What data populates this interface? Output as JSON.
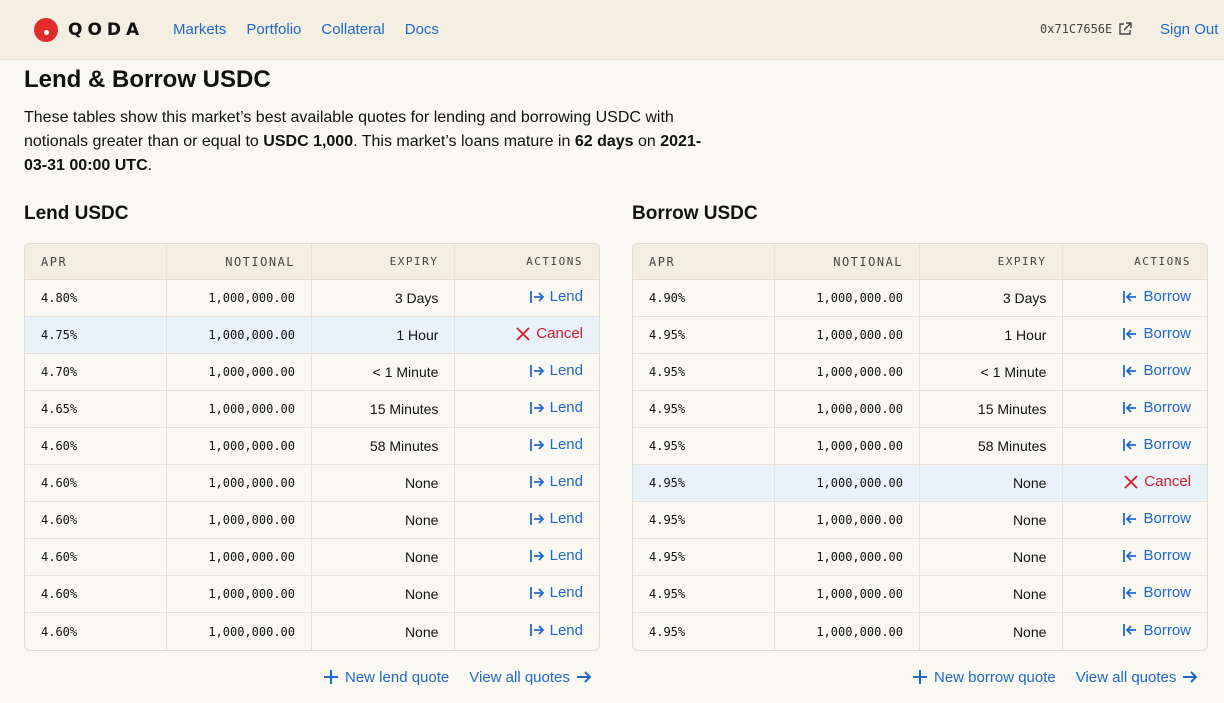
{
  "brand": {
    "name": "QODA"
  },
  "nav": {
    "items": [
      "Markets",
      "Portfolio",
      "Collateral",
      "Docs"
    ]
  },
  "header": {
    "wallet": "0x71C7656E",
    "sign_out": "Sign Out"
  },
  "page": {
    "title": "Lend & Borrow USDC",
    "intro_1": "These tables show this market’s best available quotes for lending and borrowing USDC with notionals greater than or equal to ",
    "intro_min": "USDC 1,000",
    "intro_2": ". This market’s loans mature in ",
    "intro_days": "62 days",
    "intro_3": " on ",
    "intro_date": "2021-03-31 00:00 UTC",
    "intro_4": "."
  },
  "columns": {
    "apr": "APR",
    "notional": "NOTIONAL",
    "expiry": "EXPIRY",
    "actions": "ACTIONS"
  },
  "lend": {
    "title": "Lend USDC",
    "rows": [
      {
        "apr": "4.80%",
        "notional": "1,000,000.00",
        "expiry": "3 Days",
        "action": "Lend"
      },
      {
        "apr": "4.75%",
        "notional": "1,000,000.00",
        "expiry": "1 Hour",
        "action": "Cancel"
      },
      {
        "apr": "4.70%",
        "notional": "1,000,000.00",
        "expiry": "< 1 Minute",
        "action": "Lend"
      },
      {
        "apr": "4.65%",
        "notional": "1,000,000.00",
        "expiry": "15 Minutes",
        "action": "Lend"
      },
      {
        "apr": "4.60%",
        "notional": "1,000,000.00",
        "expiry": "58 Minutes",
        "action": "Lend"
      },
      {
        "apr": "4.60%",
        "notional": "1,000,000.00",
        "expiry": "None",
        "action": "Lend"
      },
      {
        "apr": "4.60%",
        "notional": "1,000,000.00",
        "expiry": "None",
        "action": "Lend"
      },
      {
        "apr": "4.60%",
        "notional": "1,000,000.00",
        "expiry": "None",
        "action": "Lend"
      },
      {
        "apr": "4.60%",
        "notional": "1,000,000.00",
        "expiry": "None",
        "action": "Lend"
      },
      {
        "apr": "4.60%",
        "notional": "1,000,000.00",
        "expiry": "None",
        "action": "Lend"
      }
    ],
    "new_quote": "New lend quote",
    "view_all": "View all quotes"
  },
  "borrow": {
    "title": "Borrow USDC",
    "rows": [
      {
        "apr": "4.90%",
        "notional": "1,000,000.00",
        "expiry": "3 Days",
        "action": "Borrow"
      },
      {
        "apr": "4.95%",
        "notional": "1,000,000.00",
        "expiry": "1 Hour",
        "action": "Borrow"
      },
      {
        "apr": "4.95%",
        "notional": "1,000,000.00",
        "expiry": "< 1 Minute",
        "action": "Borrow"
      },
      {
        "apr": "4.95%",
        "notional": "1,000,000.00",
        "expiry": "15 Minutes",
        "action": "Borrow"
      },
      {
        "apr": "4.95%",
        "notional": "1,000,000.00",
        "expiry": "58 Minutes",
        "action": "Borrow"
      },
      {
        "apr": "4.95%",
        "notional": "1,000,000.00",
        "expiry": "None",
        "action": "Cancel"
      },
      {
        "apr": "4.95%",
        "notional": "1,000,000.00",
        "expiry": "None",
        "action": "Borrow"
      },
      {
        "apr": "4.95%",
        "notional": "1,000,000.00",
        "expiry": "None",
        "action": "Borrow"
      },
      {
        "apr": "4.95%",
        "notional": "1,000,000.00",
        "expiry": "None",
        "action": "Borrow"
      },
      {
        "apr": "4.95%",
        "notional": "1,000,000.00",
        "expiry": "None",
        "action": "Borrow"
      }
    ],
    "new_quote": "New borrow quote",
    "view_all": "View all quotes"
  },
  "colors": {
    "accent": "#2169c8",
    "danger": "#d01f26",
    "brand": "#e22b2b",
    "highlight": "#e9f1fb"
  },
  "icons": {
    "lend": "arrow-right-to-bar-icon",
    "borrow": "arrow-left-from-bar-icon",
    "cancel": "x-icon",
    "new": "plus-icon",
    "view_all": "arrow-right-icon",
    "wallet": "external-link-icon"
  }
}
